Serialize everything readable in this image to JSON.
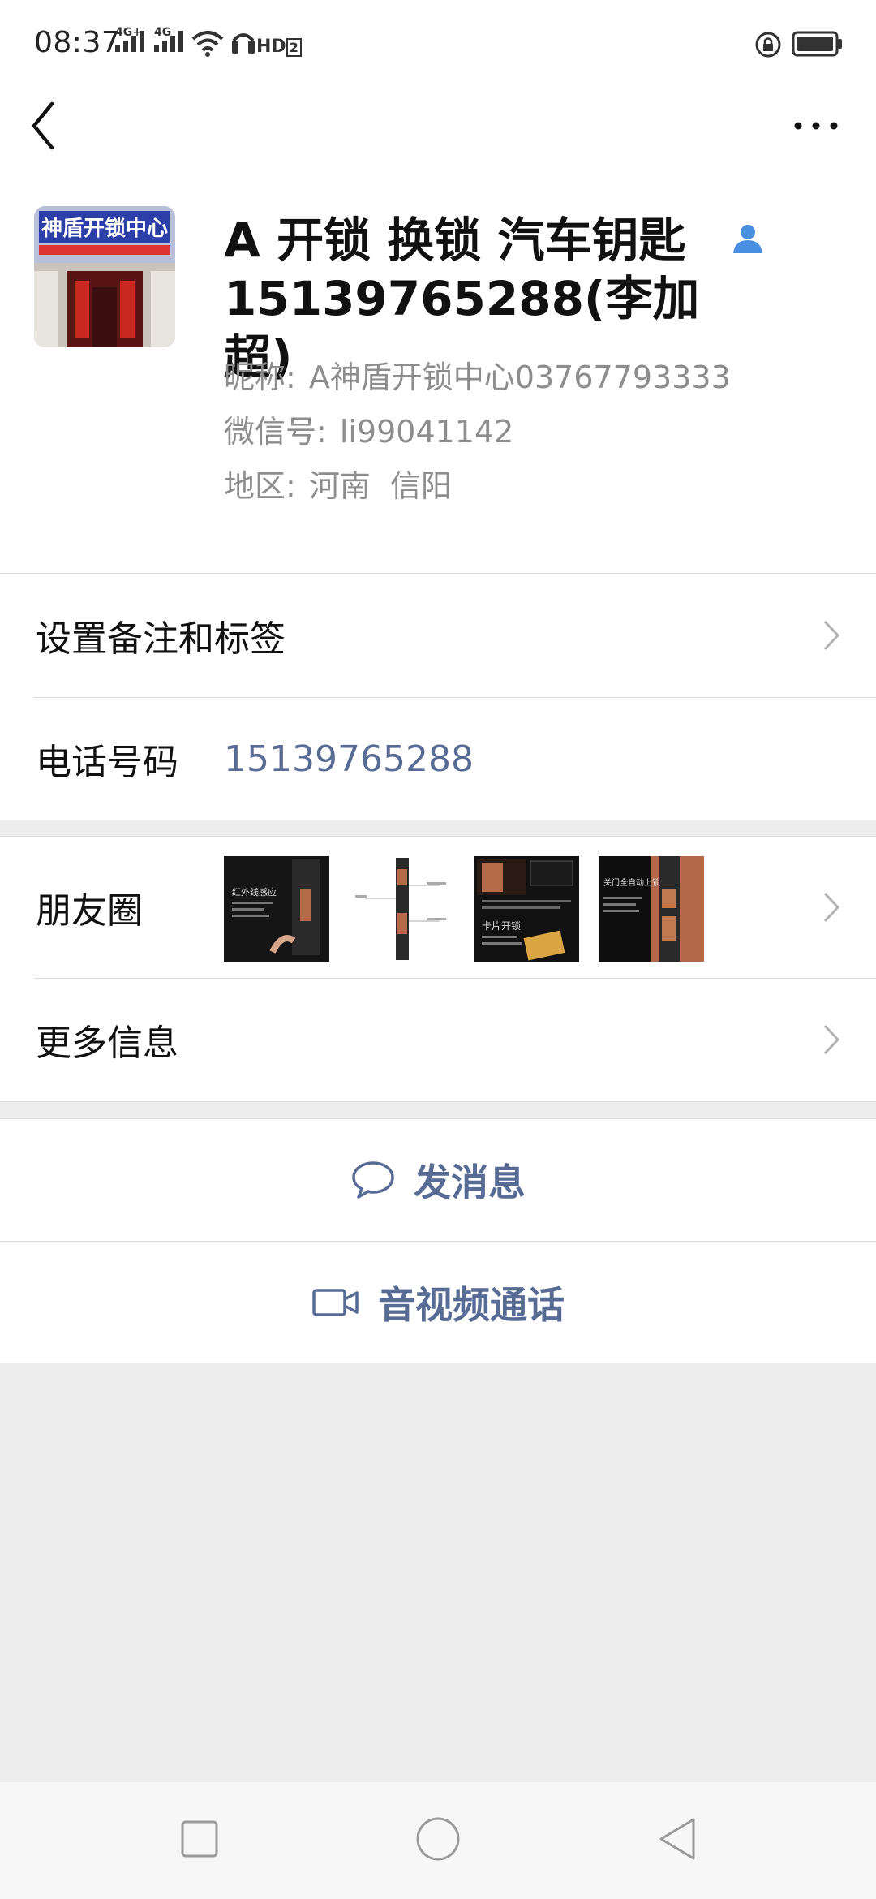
{
  "status": {
    "time": "08:37",
    "sim1_label": "4G+",
    "sim2_label": "4G",
    "hd_label": "HD",
    "hd_sub": "2"
  },
  "profile": {
    "display_name": "A 开锁 换锁 汽车钥匙 15139765288(李加超)",
    "nickname_label": "昵称:",
    "nickname": "A神盾开锁中心03767793333",
    "wechat_id_label": "微信号:",
    "wechat_id": "li99041142",
    "region_label": "地区:",
    "region": "河南  信阳",
    "avatar_sign_text": "神盾开锁中心"
  },
  "rows": {
    "remark_label": "设置备注和标签",
    "phone_label": "电话号码",
    "phone_value": "15139765288",
    "moments_label": "朋友圈",
    "more_label": "更多信息"
  },
  "moments_thumbs": [
    {
      "caption": "红外线感应"
    },
    {
      "caption": ""
    },
    {
      "caption": "卡片开锁"
    },
    {
      "caption": "关门全自动上锁"
    }
  ],
  "actions": {
    "message_label": "发消息",
    "call_label": "音视频通话"
  },
  "colors": {
    "link_blue": "#576b95",
    "contact_icon_blue": "#4a90e2",
    "background_gray": "#ededed"
  }
}
